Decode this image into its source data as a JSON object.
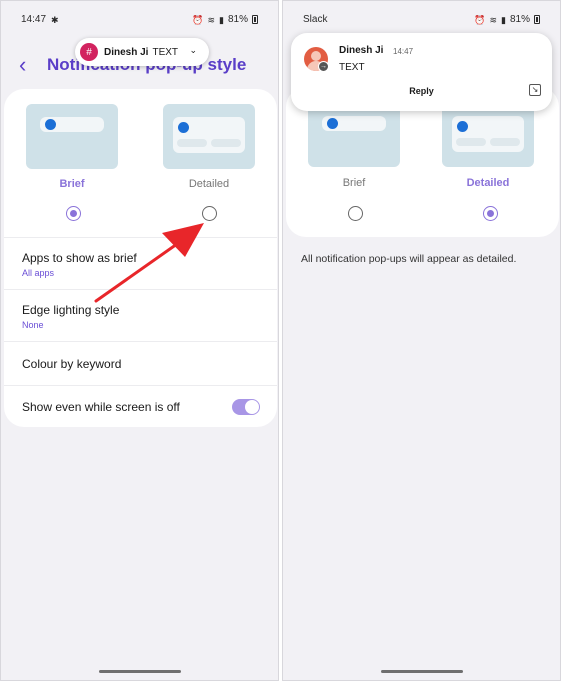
{
  "left": {
    "status": {
      "time": "14:47",
      "battery": "81%"
    },
    "header": {
      "back_icon": "chevron-left-icon",
      "title": "Notification pop-up style"
    },
    "heads_up": {
      "app_icon": "slack-icon",
      "name": "Dinesh Ji",
      "text": "TEXT"
    },
    "options": [
      {
        "label": "Brief",
        "selected": true
      },
      {
        "label": "Detailed",
        "selected": false
      }
    ],
    "rows": [
      {
        "title": "Apps to show as brief",
        "subtitle": "All apps"
      },
      {
        "title": "Edge lighting style",
        "subtitle": "None"
      },
      {
        "title": "Colour by keyword"
      },
      {
        "title": "Show even while screen is off",
        "toggle_on": true
      }
    ],
    "annotation_color": "#e8262a"
  },
  "right": {
    "status": {
      "app": "Slack",
      "battery": "81%"
    },
    "notification": {
      "name": "Dinesh Ji",
      "time": "14:47",
      "text": "TEXT",
      "reply_label": "Reply"
    },
    "options": [
      {
        "label": "Brief",
        "selected": false
      },
      {
        "label": "Detailed",
        "selected": true
      }
    ],
    "info": "All notification pop-ups will appear as detailed."
  },
  "colors": {
    "accent": "#5a3ec8",
    "radio_selected": "#8a73d9",
    "preview_bg": "#cfe1e8",
    "dot": "#1c6fd6"
  }
}
